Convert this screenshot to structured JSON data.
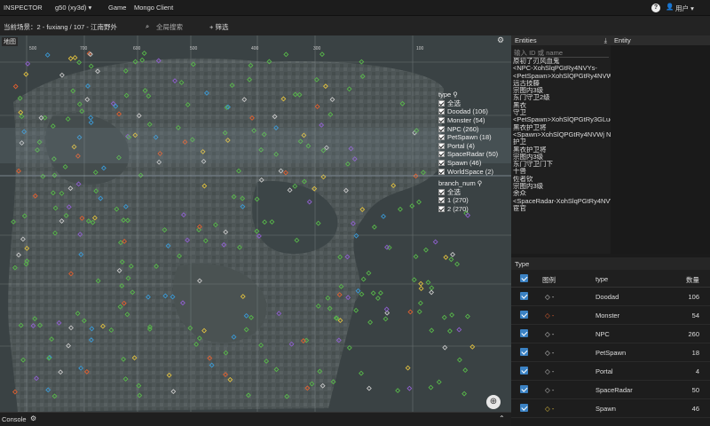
{
  "app": {
    "title": "INSPECTOR",
    "server": "g50 (xy3d)",
    "game_label": "Game",
    "mongo_label": "Mongo Client"
  },
  "subbar": {
    "current_scene": "当前场景：2 - fuxiang / 107 - 江南野外",
    "search_placeholder": "全局搜索",
    "filter_label": "筛选"
  },
  "map": {
    "title": "地图",
    "x_ticks": [
      "500",
      "700",
      "600",
      "500",
      "400",
      "300",
      "100"
    ],
    "type_filter": {
      "title": "type",
      "all_label": "全选",
      "items": [
        "Doodad (106)",
        "Monster (54)",
        "NPC (260)",
        "PetSpawn (18)",
        "Portal (4)",
        "SpaceRadar (50)",
        "Spawn (46)",
        "WorldSpace (2)"
      ]
    },
    "branch_filter": {
      "title": "branch_num",
      "all_label": "全选",
      "items": [
        "1 (270)",
        "2 (270)"
      ]
    }
  },
  "console": {
    "title": "Console"
  },
  "entities": {
    "title": "Entities",
    "search_placeholder": "输入 ID 或 name",
    "items": [
      "原初了刃风血鬼",
      "<NPC-XohSlqPGtRy4NVYs-",
      "<PetSpawn>XohSlQPGtRy4NVW",
      "远古技藤",
      "宗图内3级",
      "东门守卫2级",
      "黑衣",
      "守卫",
      "<PetSpawn>XohSlQPGtRy3GLuc",
      "黑衣护卫将",
      "<Spawn>XohSlQPGtRy4NVWj N",
      "护卫",
      "黑衣护卫将",
      "宗图内3级",
      "东门守卫门下",
      "十兽",
      "佐者钦",
      "宗图内3级",
      "余众",
      "<SpaceRadar-XohSlqPGtRy4NVW",
      "宦官"
    ]
  },
  "entity": {
    "title": "Entity"
  },
  "type_panel": {
    "title": "Type",
    "headers": {
      "icon": "图例",
      "type": "type",
      "count": "数量"
    },
    "rows": [
      {
        "icon": "diamond-icon",
        "color": "#d9d9d9",
        "type": "Doodad",
        "count": "106"
      },
      {
        "icon": "monster-icon",
        "color": "#e06030",
        "type": "Monster",
        "count": "54"
      },
      {
        "icon": "diamond-icon",
        "color": "#d9d9d9",
        "type": "NPC",
        "count": "260"
      },
      {
        "icon": "diamond-icon",
        "color": "#d9d9d9",
        "type": "PetSpawn",
        "count": "18"
      },
      {
        "icon": "portal-icon",
        "color": "#c7c7c7",
        "type": "Portal",
        "count": "4"
      },
      {
        "icon": "radar-icon",
        "color": "#c7c7c7",
        "type": "SpaceRadar",
        "count": "50"
      },
      {
        "icon": "spawn-icon",
        "color": "#e0c040",
        "type": "Spawn",
        "count": "46"
      }
    ]
  },
  "colors": {
    "npc": "#58b84a",
    "petspawn": "#3b9ad6",
    "monster": "#e06030",
    "spawn": "#e0c040",
    "doodad": "#c8c8c8",
    "radar": "#9060d0",
    "accent": "#3b82c4"
  }
}
